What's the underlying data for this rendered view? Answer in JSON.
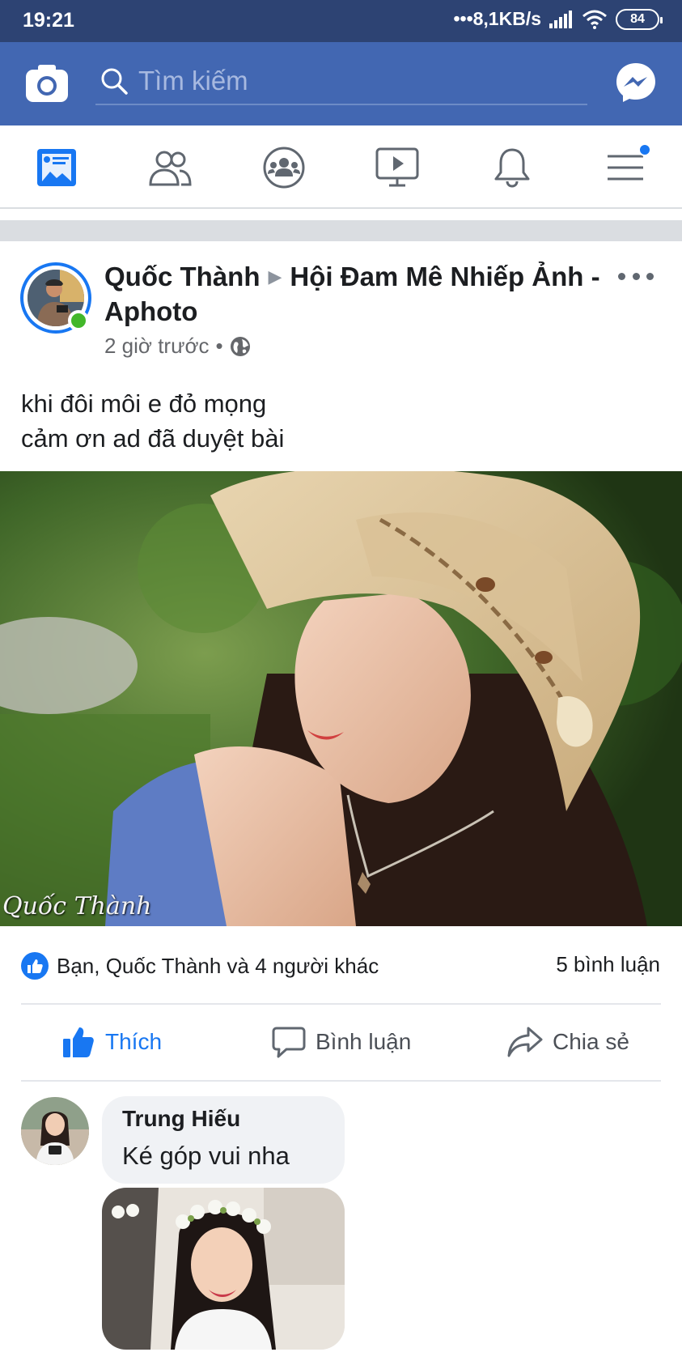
{
  "status_bar": {
    "time": "19:21",
    "network_speed": "•••8,1KB/s",
    "battery": "84"
  },
  "app_bar": {
    "search_placeholder": "Tìm kiếm",
    "icons": [
      "camera-icon",
      "search-icon",
      "messenger-icon"
    ]
  },
  "nav_tabs": [
    {
      "name": "news-feed",
      "icon": "news-feed-icon",
      "active": true
    },
    {
      "name": "friends",
      "icon": "friends-icon",
      "active": false
    },
    {
      "name": "groups",
      "icon": "groups-icon",
      "active": false
    },
    {
      "name": "watch",
      "icon": "watch-icon",
      "active": false
    },
    {
      "name": "notifications",
      "icon": "bell-icon",
      "active": false
    },
    {
      "name": "menu",
      "icon": "menu-icon",
      "active": false,
      "badge": true
    }
  ],
  "post": {
    "author": "Quốc Thành",
    "group": "Hội  Đam Mê Nhiếp Ảnh - Aphoto",
    "time": "2 giờ trước",
    "privacy_separator": "•",
    "text_line1": "khi đôi môi e đỏ mọng",
    "text_line2": "cảm ơn ad đã duyệt bài",
    "photo_watermark": "Quốc Thành",
    "reactions_text": "Bạn, Quốc Thành và 4 người khác",
    "comments_count": "5 bình luận",
    "actions": {
      "like": "Thích",
      "comment": "Bình luận",
      "share": "Chia sẻ"
    }
  },
  "comment": {
    "author": "Trung Hiếu",
    "text": "Ké góp vui nha"
  },
  "colors": {
    "status_bar": "#2d4373",
    "app_bar": "#4267b2",
    "accent": "#1877f2",
    "online": "#42b72a"
  }
}
